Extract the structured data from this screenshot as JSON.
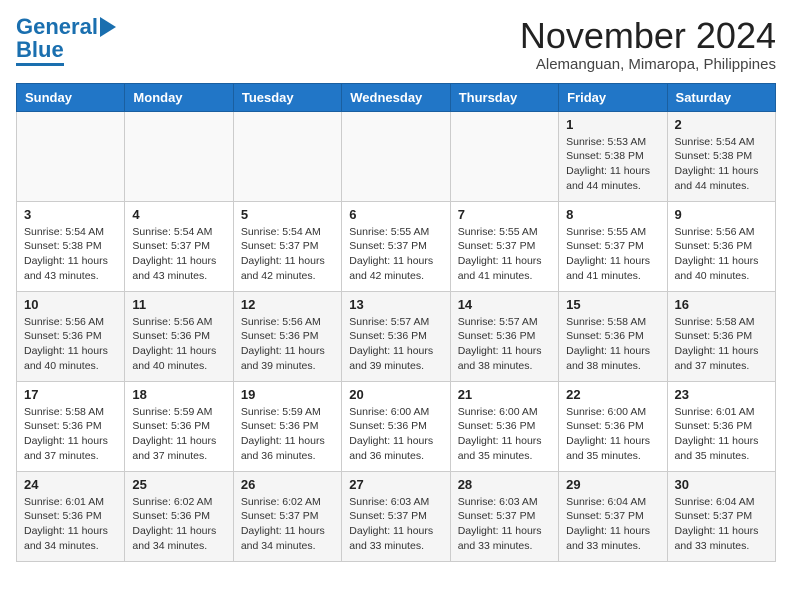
{
  "header": {
    "logo_top": "General",
    "logo_bottom": "Blue",
    "month": "November 2024",
    "location": "Alemanguan, Mimaropa, Philippines"
  },
  "weekdays": [
    "Sunday",
    "Monday",
    "Tuesday",
    "Wednesday",
    "Thursday",
    "Friday",
    "Saturday"
  ],
  "weeks": [
    [
      {
        "day": "",
        "info": ""
      },
      {
        "day": "",
        "info": ""
      },
      {
        "day": "",
        "info": ""
      },
      {
        "day": "",
        "info": ""
      },
      {
        "day": "",
        "info": ""
      },
      {
        "day": "1",
        "info": "Sunrise: 5:53 AM\nSunset: 5:38 PM\nDaylight: 11 hours\nand 44 minutes."
      },
      {
        "day": "2",
        "info": "Sunrise: 5:54 AM\nSunset: 5:38 PM\nDaylight: 11 hours\nand 44 minutes."
      }
    ],
    [
      {
        "day": "3",
        "info": "Sunrise: 5:54 AM\nSunset: 5:38 PM\nDaylight: 11 hours\nand 43 minutes."
      },
      {
        "day": "4",
        "info": "Sunrise: 5:54 AM\nSunset: 5:37 PM\nDaylight: 11 hours\nand 43 minutes."
      },
      {
        "day": "5",
        "info": "Sunrise: 5:54 AM\nSunset: 5:37 PM\nDaylight: 11 hours\nand 42 minutes."
      },
      {
        "day": "6",
        "info": "Sunrise: 5:55 AM\nSunset: 5:37 PM\nDaylight: 11 hours\nand 42 minutes."
      },
      {
        "day": "7",
        "info": "Sunrise: 5:55 AM\nSunset: 5:37 PM\nDaylight: 11 hours\nand 41 minutes."
      },
      {
        "day": "8",
        "info": "Sunrise: 5:55 AM\nSunset: 5:37 PM\nDaylight: 11 hours\nand 41 minutes."
      },
      {
        "day": "9",
        "info": "Sunrise: 5:56 AM\nSunset: 5:36 PM\nDaylight: 11 hours\nand 40 minutes."
      }
    ],
    [
      {
        "day": "10",
        "info": "Sunrise: 5:56 AM\nSunset: 5:36 PM\nDaylight: 11 hours\nand 40 minutes."
      },
      {
        "day": "11",
        "info": "Sunrise: 5:56 AM\nSunset: 5:36 PM\nDaylight: 11 hours\nand 40 minutes."
      },
      {
        "day": "12",
        "info": "Sunrise: 5:56 AM\nSunset: 5:36 PM\nDaylight: 11 hours\nand 39 minutes."
      },
      {
        "day": "13",
        "info": "Sunrise: 5:57 AM\nSunset: 5:36 PM\nDaylight: 11 hours\nand 39 minutes."
      },
      {
        "day": "14",
        "info": "Sunrise: 5:57 AM\nSunset: 5:36 PM\nDaylight: 11 hours\nand 38 minutes."
      },
      {
        "day": "15",
        "info": "Sunrise: 5:58 AM\nSunset: 5:36 PM\nDaylight: 11 hours\nand 38 minutes."
      },
      {
        "day": "16",
        "info": "Sunrise: 5:58 AM\nSunset: 5:36 PM\nDaylight: 11 hours\nand 37 minutes."
      }
    ],
    [
      {
        "day": "17",
        "info": "Sunrise: 5:58 AM\nSunset: 5:36 PM\nDaylight: 11 hours\nand 37 minutes."
      },
      {
        "day": "18",
        "info": "Sunrise: 5:59 AM\nSunset: 5:36 PM\nDaylight: 11 hours\nand 37 minutes."
      },
      {
        "day": "19",
        "info": "Sunrise: 5:59 AM\nSunset: 5:36 PM\nDaylight: 11 hours\nand 36 minutes."
      },
      {
        "day": "20",
        "info": "Sunrise: 6:00 AM\nSunset: 5:36 PM\nDaylight: 11 hours\nand 36 minutes."
      },
      {
        "day": "21",
        "info": "Sunrise: 6:00 AM\nSunset: 5:36 PM\nDaylight: 11 hours\nand 35 minutes."
      },
      {
        "day": "22",
        "info": "Sunrise: 6:00 AM\nSunset: 5:36 PM\nDaylight: 11 hours\nand 35 minutes."
      },
      {
        "day": "23",
        "info": "Sunrise: 6:01 AM\nSunset: 5:36 PM\nDaylight: 11 hours\nand 35 minutes."
      }
    ],
    [
      {
        "day": "24",
        "info": "Sunrise: 6:01 AM\nSunset: 5:36 PM\nDaylight: 11 hours\nand 34 minutes."
      },
      {
        "day": "25",
        "info": "Sunrise: 6:02 AM\nSunset: 5:36 PM\nDaylight: 11 hours\nand 34 minutes."
      },
      {
        "day": "26",
        "info": "Sunrise: 6:02 AM\nSunset: 5:37 PM\nDaylight: 11 hours\nand 34 minutes."
      },
      {
        "day": "27",
        "info": "Sunrise: 6:03 AM\nSunset: 5:37 PM\nDaylight: 11 hours\nand 33 minutes."
      },
      {
        "day": "28",
        "info": "Sunrise: 6:03 AM\nSunset: 5:37 PM\nDaylight: 11 hours\nand 33 minutes."
      },
      {
        "day": "29",
        "info": "Sunrise: 6:04 AM\nSunset: 5:37 PM\nDaylight: 11 hours\nand 33 minutes."
      },
      {
        "day": "30",
        "info": "Sunrise: 6:04 AM\nSunset: 5:37 PM\nDaylight: 11 hours\nand 33 minutes."
      }
    ]
  ]
}
